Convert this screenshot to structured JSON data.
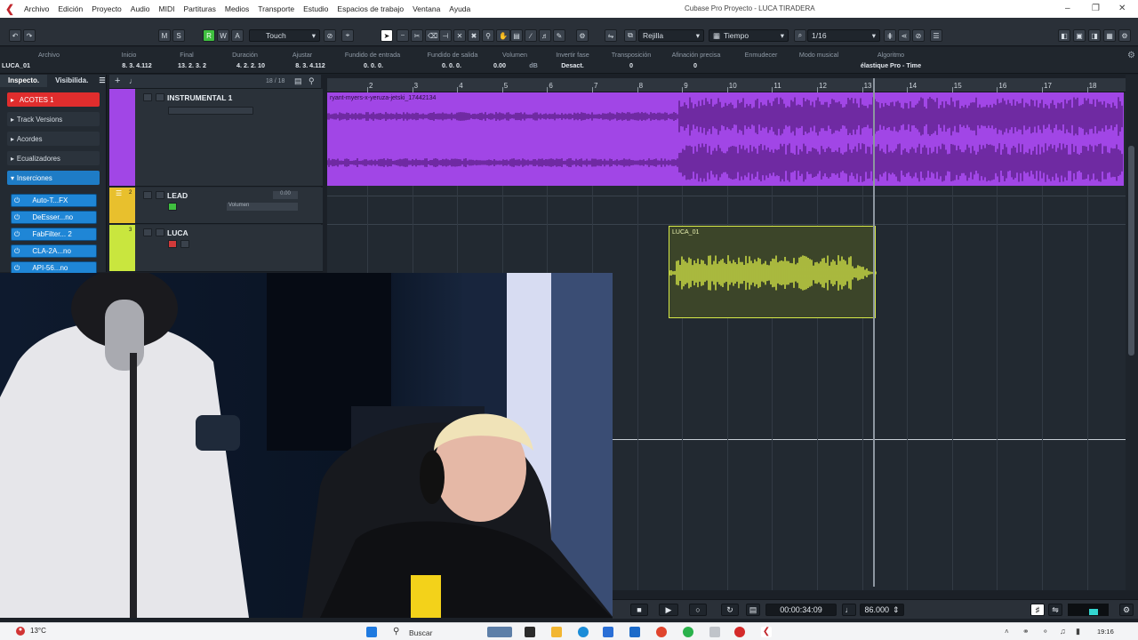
{
  "titlebar": {
    "menu": [
      "Archivo",
      "Edición",
      "Proyecto",
      "Audio",
      "MIDI",
      "Partituras",
      "Medios",
      "Transporte",
      "Estudio",
      "Espacios de trabajo",
      "Ventana",
      "Ayuda"
    ],
    "window_title": "Cubase Pro Proyecto - LUCA TIRADERA"
  },
  "toolbar": {
    "m": "M",
    "s": "S",
    "r": "R",
    "w": "W",
    "a": "A",
    "automation_mode": "Touch",
    "snap_type": "Rejilla",
    "grid_type": "Tiempo",
    "quantize": "1/16"
  },
  "infoline": {
    "headers": [
      "Archivo",
      "Inicio",
      "Final",
      "Duración",
      "Ajustar",
      "Fundido de entrada",
      "Fundido de salida",
      "Volumen",
      "Invertir fase",
      "Transposición",
      "Afinación precisa",
      "Enmudecer",
      "Modo musical",
      "Algoritmo"
    ],
    "values": [
      "LUCA_01",
      "8. 3. 4.112",
      "13. 2. 3.   2",
      "4. 2. 2. 10",
      "8. 3. 4.112",
      "0. 0. 0.",
      "0. 0. 0.",
      "0.00",
      "dB",
      "Desact.",
      "0",
      "0",
      "",
      "élastique Pro - Time"
    ]
  },
  "inspector": {
    "tab_inspector": "Inspecto.",
    "tab_visibility": "Visibilida.",
    "track_name": "ACOTES 1",
    "sections": [
      "Track Versions",
      "Acordes",
      "Ecualizadores",
      "Inserciones"
    ],
    "inserts": [
      "Auto-T...FX",
      "DeEsser...no",
      "FabFilter... 2",
      "CLA-2A...no",
      "API-56...no"
    ]
  },
  "tracklist": {
    "count": "18 / 18",
    "tracks": [
      {
        "num": "",
        "name": "INSTRUMENTAL 1",
        "color": "#a146e6"
      },
      {
        "num": "2",
        "name": "LEAD",
        "color": "#e8c02d",
        "volume_value": "0.00",
        "volume_label": "Volumen"
      },
      {
        "num": "3",
        "name": "LUCA",
        "color": "#c9e63e"
      }
    ]
  },
  "ruler": {
    "bars": [
      "2",
      "3",
      "4",
      "5",
      "6",
      "7",
      "8",
      "9",
      "10",
      "11",
      "12",
      "13",
      "14",
      "15",
      "16",
      "17",
      "18"
    ]
  },
  "clips": {
    "instrumental": "ryant-myers-x-yeruza-jetski_17442134",
    "luca": "LUCA_01"
  },
  "transport": {
    "time": "00:00:34:09",
    "tempo": "86.000"
  },
  "taskbar": {
    "temp": "13°C",
    "search": "Buscar",
    "clock_time": "19:16"
  }
}
